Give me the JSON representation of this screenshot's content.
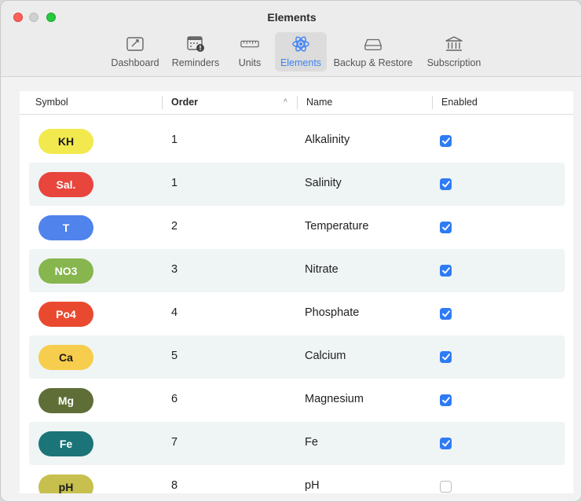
{
  "window": {
    "title": "Elements"
  },
  "toolbar": {
    "items": [
      {
        "label": "Dashboard",
        "icon": "dashboard-icon",
        "selected": false
      },
      {
        "label": "Reminders",
        "icon": "calendar-alert-icon",
        "selected": false
      },
      {
        "label": "Units",
        "icon": "ruler-icon",
        "selected": false
      },
      {
        "label": "Elements",
        "icon": "atom-icon",
        "selected": true
      },
      {
        "label": "Backup & Restore",
        "icon": "drive-icon",
        "selected": false
      },
      {
        "label": "Subscription",
        "icon": "bank-icon",
        "selected": false
      }
    ],
    "accent_color": "#3d82f6"
  },
  "table": {
    "columns": [
      "Symbol",
      "Order",
      "Name",
      "Enabled"
    ],
    "sort_indicator": "^",
    "rows": [
      {
        "symbol": "KH",
        "order": "1",
        "name": "Alkalinity",
        "enabled": true,
        "color": "#f2e94e",
        "text_color": "#1a1a1a"
      },
      {
        "symbol": "Sal.",
        "order": "1",
        "name": "Salinity",
        "enabled": true,
        "color": "#e8453c",
        "text_color": "#ffffff"
      },
      {
        "symbol": "T",
        "order": "2",
        "name": "Temperature",
        "enabled": true,
        "color": "#5083ec",
        "text_color": "#ffffff"
      },
      {
        "symbol": "NO3",
        "order": "3",
        "name": "Nitrate",
        "enabled": true,
        "color": "#87b54e",
        "text_color": "#ffffff"
      },
      {
        "symbol": "Po4",
        "order": "4",
        "name": "Phosphate",
        "enabled": true,
        "color": "#e94a2f",
        "text_color": "#ffffff"
      },
      {
        "symbol": "Ca",
        "order": "5",
        "name": "Calcium",
        "enabled": true,
        "color": "#f6cd4c",
        "text_color": "#1a1a1a"
      },
      {
        "symbol": "Mg",
        "order": "6",
        "name": "Magnesium",
        "enabled": true,
        "color": "#5e6e36",
        "text_color": "#ffffff"
      },
      {
        "symbol": "Fe",
        "order": "7",
        "name": "Fe",
        "enabled": true,
        "color": "#1b7478",
        "text_color": "#ffffff"
      },
      {
        "symbol": "pH",
        "order": "8",
        "name": "pH",
        "enabled": false,
        "color": "#c7c04e",
        "text_color": "#1a1a1a"
      }
    ]
  }
}
